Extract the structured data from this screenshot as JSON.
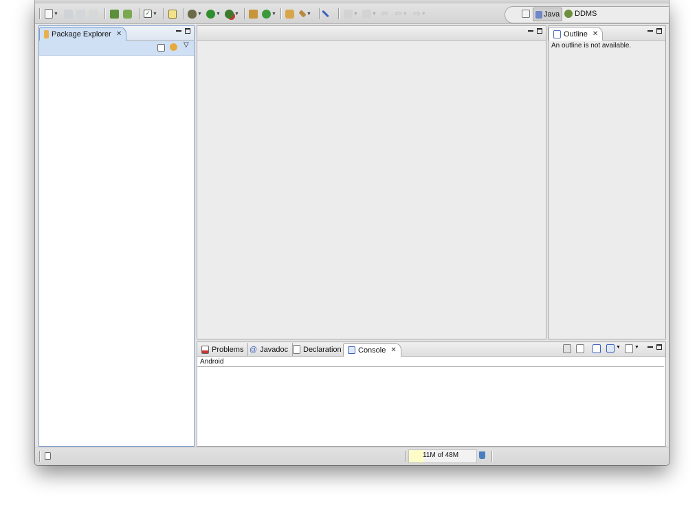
{
  "colors": {
    "window_bg": "#e6e6e6",
    "panel_bg": "#ffffff",
    "editor_bg": "#ececec",
    "active_tab_fill": "#cfe0f5",
    "heap_fill": "#fdfbc8"
  },
  "toolbar": {
    "icons": [
      "new-icon",
      "save-icon",
      "save-all-icon",
      "print-icon",
      "android-sdk-icon",
      "android-avd-icon",
      "task-icon",
      "new-java-project-icon",
      "debug-icon",
      "run-icon",
      "external-tools-icon",
      "new-package-icon",
      "new-class-icon",
      "open-type-icon",
      "search-icon",
      "toggle-mark-icon",
      "next-annotation-icon",
      "previous-annotation-icon",
      "back-icon",
      "forward-icon"
    ]
  },
  "perspectives": {
    "open_perspective_icon": "open-perspective-icon",
    "java_label": "Java",
    "ddms_label": "DDMS"
  },
  "package_explorer": {
    "tab_label": "Package Explorer",
    "tab_icon": "package-explorer-icon",
    "collapse_icon": "collapse-all-icon",
    "link_icon": "link-with-editor-icon",
    "menu_icon": "view-menu-icon"
  },
  "outline": {
    "tab_label": "Outline",
    "message": "An outline is not available."
  },
  "bottom_panel": {
    "tabs": [
      {
        "label": "Problems",
        "icon": "problems-icon"
      },
      {
        "label": "Javadoc",
        "icon": "javadoc-icon"
      },
      {
        "label": "Declaration",
        "icon": "declaration-icon"
      },
      {
        "label": "Console",
        "icon": "console-icon"
      }
    ],
    "console_name": "Android"
  },
  "statusbar": {
    "heap_text": "11M of 48M",
    "fast_view_icon": "fast-view-icon",
    "gc_icon": "trash-icon"
  }
}
